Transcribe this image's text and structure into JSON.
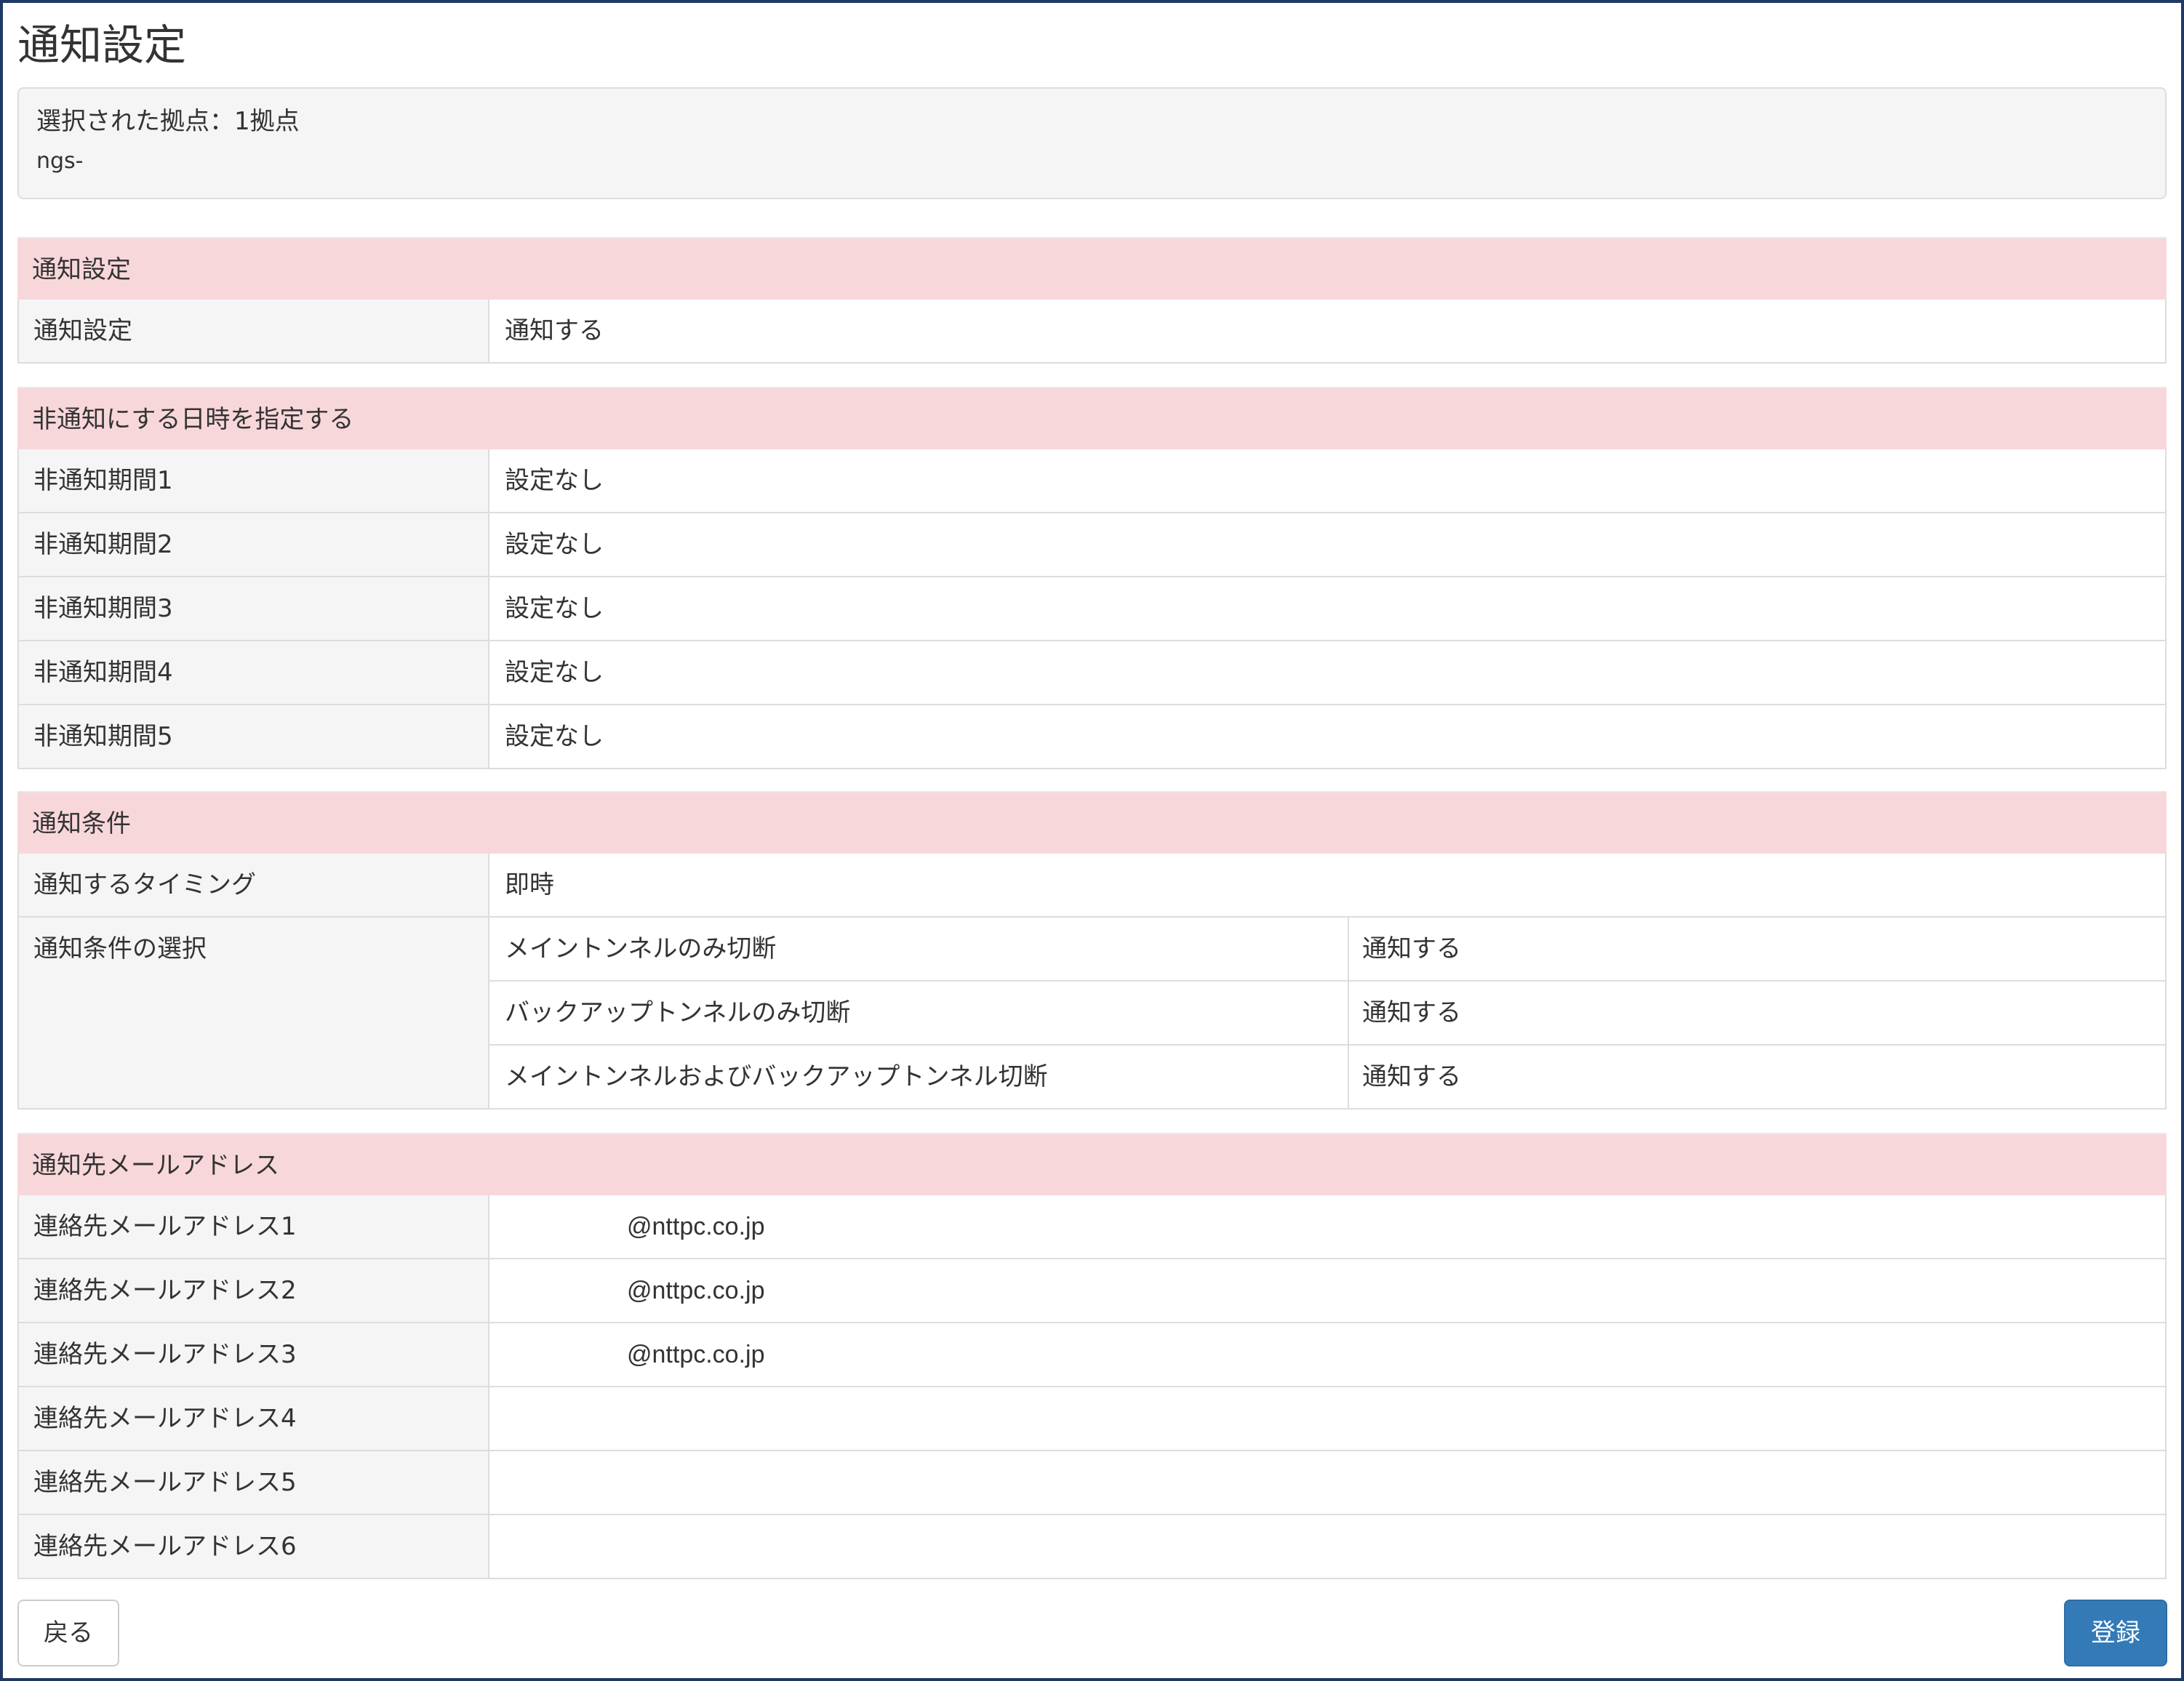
{
  "page": {
    "title": "通知設定"
  },
  "selection": {
    "summary": "選択された拠点：1拠点",
    "site": "ngs-"
  },
  "section_notify": {
    "header": "通知設定",
    "rows": [
      {
        "label": "通知設定",
        "value": "通知する"
      }
    ]
  },
  "section_mute": {
    "header": "非通知にする日時を指定する",
    "rows": [
      {
        "label": "非通知期間1",
        "value": "設定なし"
      },
      {
        "label": "非通知期間2",
        "value": "設定なし"
      },
      {
        "label": "非通知期間3",
        "value": "設定なし"
      },
      {
        "label": "非通知期間4",
        "value": "設定なし"
      },
      {
        "label": "非通知期間5",
        "value": "設定なし"
      }
    ]
  },
  "section_conditions": {
    "header": "通知条件",
    "timing": {
      "label": "通知するタイミング",
      "value": "即時"
    },
    "selection_label": "通知条件の選択",
    "conditions": [
      {
        "name": "メイントンネルのみ切断",
        "value": "通知する"
      },
      {
        "name": "バックアップトンネルのみ切断",
        "value": "通知する"
      },
      {
        "name": "メイントンネルおよびバックアップトンネル切断",
        "value": "通知する"
      }
    ]
  },
  "section_email": {
    "header": "通知先メールアドレス",
    "rows": [
      {
        "label": "連絡先メールアドレス1",
        "value": "@nttpc.co.jp"
      },
      {
        "label": "連絡先メールアドレス2",
        "value": "@nttpc.co.jp"
      },
      {
        "label": "連絡先メールアドレス3",
        "value": "@nttpc.co.jp"
      },
      {
        "label": "連絡先メールアドレス4",
        "value": ""
      },
      {
        "label": "連絡先メールアドレス5",
        "value": ""
      },
      {
        "label": "連絡先メールアドレス6",
        "value": ""
      }
    ]
  },
  "buttons": {
    "back": "戻る",
    "submit": "登録"
  },
  "colors": {
    "section_header_bg": "#f8d7da",
    "label_bg": "#f5f5f5",
    "primary_button": "#337ab7",
    "frame_border": "#1f3864"
  }
}
